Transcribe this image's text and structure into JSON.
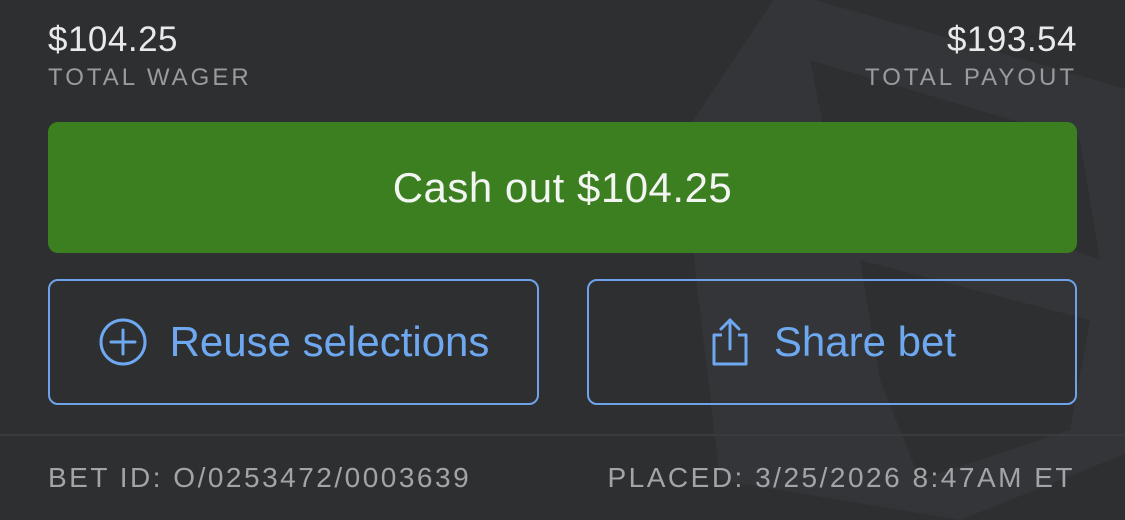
{
  "summary": {
    "total_wager_amount": "$104.25",
    "total_wager_label": "TOTAL WAGER",
    "total_payout_amount": "$193.54",
    "total_payout_label": "TOTAL PAYOUT"
  },
  "actions": {
    "cashout_label": "Cash out $104.25",
    "reuse_label": "Reuse selections",
    "reuse_icon": "plus-circle-icon",
    "share_label": "Share bet",
    "share_icon": "share-icon"
  },
  "footer": {
    "bet_id": "BET ID: O/0253472/0003639",
    "placed": "PLACED: 3/25/2026 8:47AM ET"
  },
  "colors": {
    "background": "#2e2f31",
    "cashout_green": "#3c7f21",
    "accent_blue": "#6ea8f0"
  }
}
